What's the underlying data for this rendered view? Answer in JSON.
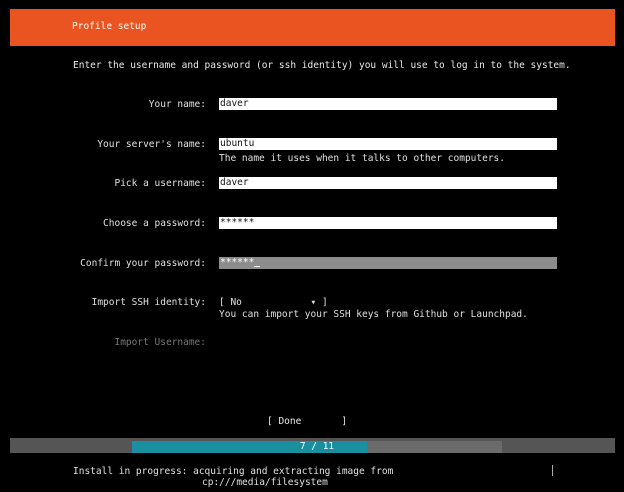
{
  "header": {
    "title": "Profile setup"
  },
  "intro": "Enter the username and password (or ssh identity) you will use to log in to the system.",
  "fields": {
    "name": {
      "label": "Your name:",
      "value": "daver"
    },
    "server_name": {
      "label": "Your server's name:",
      "value": "ubuntu",
      "help": "The name it uses when it talks to other computers."
    },
    "username": {
      "label": "Pick a username:",
      "value": "daver"
    },
    "password": {
      "label": "Choose a password:",
      "value": "******"
    },
    "confirm_password": {
      "label": "Confirm your password:",
      "value": "******"
    }
  },
  "ssh": {
    "label": "Import SSH identity:",
    "select_text": "[ No            ▾ ]",
    "selected": "No",
    "help": "You can import your SSH keys from Github or Launchpad.",
    "username_label": "Import Username:"
  },
  "done_button": "[ Done       ]",
  "progress": {
    "text": "7 / 11",
    "current": 7,
    "total": 11
  },
  "status": {
    "line1": "Install in progress: acquiring and extracting image from",
    "line2": "cp:///media/filesystem"
  },
  "colors": {
    "accent": "#e95420",
    "progress": "#1a8f9f",
    "background": "#000000"
  }
}
